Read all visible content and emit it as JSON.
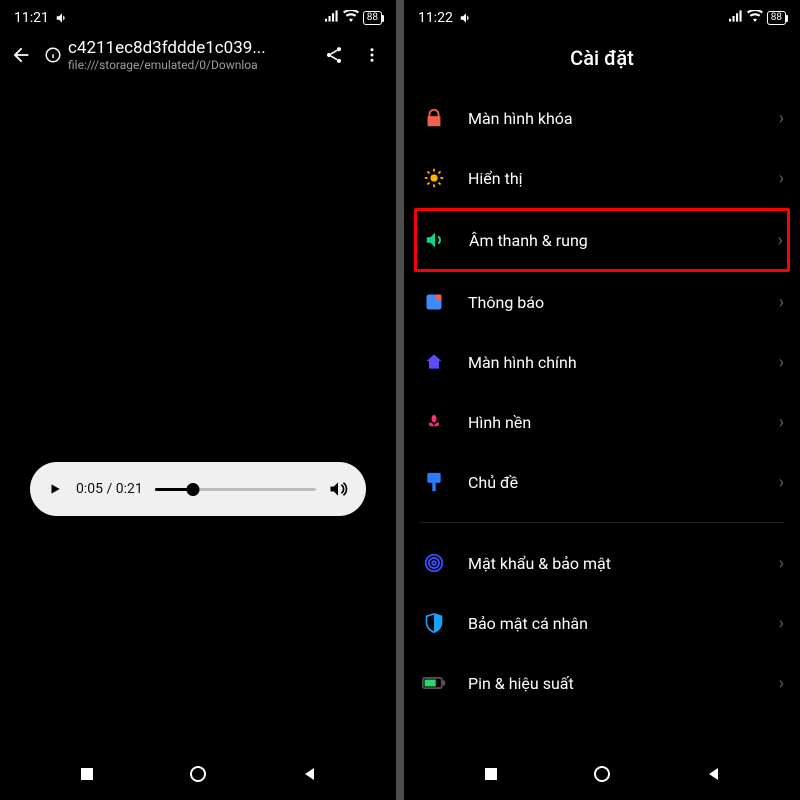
{
  "left": {
    "status": {
      "time": "11:21",
      "battery": "88"
    },
    "appbar": {
      "title": "c4211ec8d3fddde1c039...",
      "subtitle": "file:///storage/emulated/0/Downloa"
    },
    "player": {
      "current": "0:05",
      "duration": "0:21",
      "progress_pct": 24
    }
  },
  "right": {
    "status": {
      "time": "11:22",
      "battery": "88"
    },
    "title": "Cài đặt",
    "items": [
      {
        "label": "Màn hình khóa",
        "icon": "lock",
        "color": "#f06050"
      },
      {
        "label": "Hiển thị",
        "icon": "sun",
        "color": "#ffb200"
      },
      {
        "label": "Âm thanh & rung",
        "icon": "sound",
        "color": "#14d38b",
        "highlight": true
      },
      {
        "label": "Thông báo",
        "icon": "notif",
        "color": "#3e8bff"
      },
      {
        "label": "Màn hình chính",
        "icon": "home",
        "color": "#5b4dff"
      },
      {
        "label": "Hình nền",
        "icon": "wallpaper",
        "color": "#ff2f6b"
      },
      {
        "label": "Chủ đề",
        "icon": "theme",
        "color": "#2f7bff"
      }
    ],
    "items2": [
      {
        "label": "Mật khẩu & bảo mật",
        "icon": "fingerprint",
        "color": "#3d4bff"
      },
      {
        "label": "Bảo mật cá nhân",
        "icon": "shield",
        "color": "#1aa0ff"
      },
      {
        "label": "Pin & hiệu suất",
        "icon": "battery",
        "color": "#2bd66a"
      }
    ]
  }
}
